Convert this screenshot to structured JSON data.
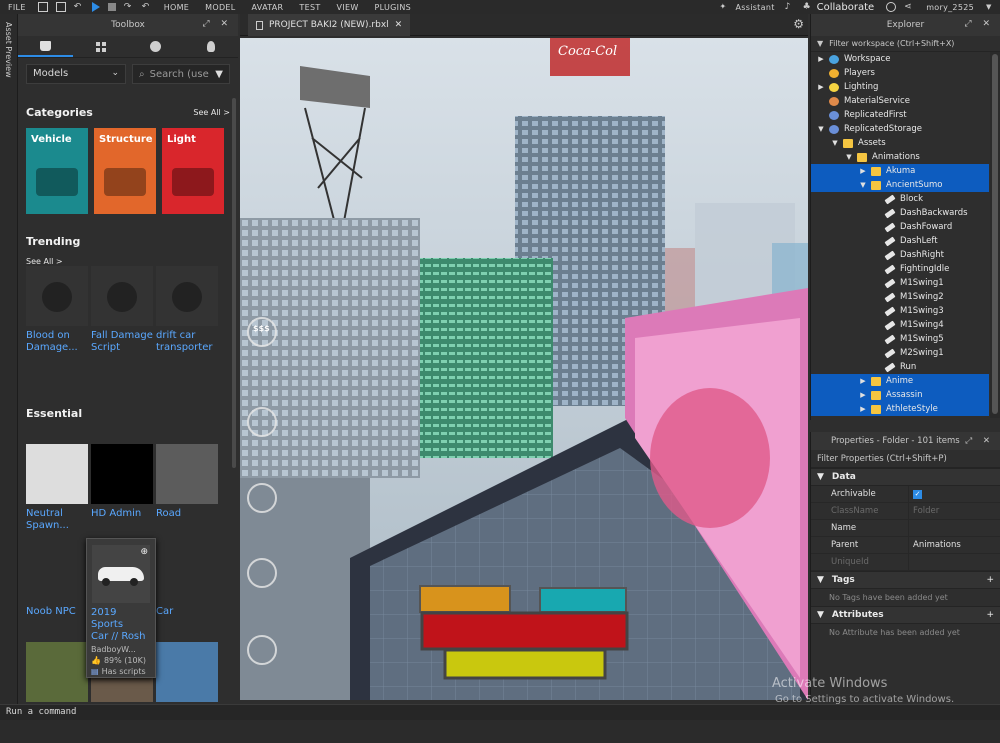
{
  "topbar": {
    "file": "FILE",
    "menus": [
      "HOME",
      "MODEL",
      "AVATAR",
      "TEST",
      "VIEW",
      "PLUGINS"
    ],
    "assistant": "Assistant",
    "collaborate": "Collaborate",
    "user": "mory_2525"
  },
  "leftstrip": {
    "label": "Asset Preview"
  },
  "toolbox": {
    "title": "Toolbox",
    "category_select": "Models",
    "search_placeholder": "Search (use",
    "categories_title": "Categories",
    "see_all": "See All >",
    "categories": [
      {
        "label": "Vehicle",
        "color": "#1b8a8e"
      },
      {
        "label": "Structure",
        "color": "#e2672b"
      },
      {
        "label": "Light",
        "color": "#d9262c"
      }
    ],
    "trending_title": "Trending",
    "trending_see_all": "See All >",
    "trending": [
      {
        "l1": "Blood on",
        "l2": "Damage..."
      },
      {
        "l1": "Fall Damage",
        "l2": "Script"
      },
      {
        "l1": "drift car",
        "l2": "transporter"
      }
    ],
    "essential_title": "Essential",
    "essential": [
      {
        "l1": "Neutral",
        "l2": "Spawn..."
      },
      {
        "l1": "HD Admin",
        "l2": ""
      },
      {
        "l1": "Road",
        "l2": ""
      }
    ],
    "row3": [
      {
        "l1": "Noob NPC"
      },
      {
        "l1": ""
      },
      {
        "l1": "Car"
      }
    ],
    "popup": {
      "name1": "2019 Sports",
      "name2": "Car // Rosh",
      "creator": "BadboyW...",
      "rating": "89% (10K)",
      "scripts": "Has scripts"
    }
  },
  "viewport": {
    "tab": "PROJECT BAKI2 (NEW).rbxl",
    "billboard": "Coca-Col",
    "side_icon": "$$$"
  },
  "explorer": {
    "title": "Explorer",
    "filter": "Filter workspace (Ctrl+Shift+X)",
    "items": [
      {
        "label": "Workspace",
        "depth": 0,
        "arrow": "▶",
        "icon": "#4aa3df",
        "sel": false
      },
      {
        "label": "Players",
        "depth": 0,
        "arrow": "",
        "icon": "#f0b030",
        "sel": false
      },
      {
        "label": "Lighting",
        "depth": 0,
        "arrow": "▶",
        "icon": "#f5d442",
        "sel": false
      },
      {
        "label": "MaterialService",
        "depth": 0,
        "arrow": "",
        "icon": "#e08a4a",
        "sel": false
      },
      {
        "label": "ReplicatedFirst",
        "depth": 0,
        "arrow": "",
        "icon": "#6a8fd8",
        "sel": false
      },
      {
        "label": "ReplicatedStorage",
        "depth": 0,
        "arrow": "▼",
        "icon": "#6a8fd8",
        "sel": false
      },
      {
        "label": "Assets",
        "depth": 1,
        "arrow": "▼",
        "icon": "folder",
        "sel": false
      },
      {
        "label": "Animations",
        "depth": 2,
        "arrow": "▼",
        "icon": "folder",
        "sel": false
      },
      {
        "label": "Akuma",
        "depth": 3,
        "arrow": "▶",
        "icon": "folder",
        "sel": true
      },
      {
        "label": "AncientSumo",
        "depth": 3,
        "arrow": "▼",
        "icon": "folder",
        "sel": true
      },
      {
        "label": "Block",
        "depth": 4,
        "arrow": "",
        "icon": "anim",
        "sel": false
      },
      {
        "label": "DashBackwards",
        "depth": 4,
        "arrow": "",
        "icon": "anim",
        "sel": false
      },
      {
        "label": "DashFoward",
        "depth": 4,
        "arrow": "",
        "icon": "anim",
        "sel": false
      },
      {
        "label": "DashLeft",
        "depth": 4,
        "arrow": "",
        "icon": "anim",
        "sel": false
      },
      {
        "label": "DashRight",
        "depth": 4,
        "arrow": "",
        "icon": "anim",
        "sel": false
      },
      {
        "label": "FightingIdle",
        "depth": 4,
        "arrow": "",
        "icon": "anim",
        "sel": false
      },
      {
        "label": "M1Swing1",
        "depth": 4,
        "arrow": "",
        "icon": "anim",
        "sel": false
      },
      {
        "label": "M1Swing2",
        "depth": 4,
        "arrow": "",
        "icon": "anim",
        "sel": false
      },
      {
        "label": "M1Swing3",
        "depth": 4,
        "arrow": "",
        "icon": "anim",
        "sel": false
      },
      {
        "label": "M1Swing4",
        "depth": 4,
        "arrow": "",
        "icon": "anim",
        "sel": false
      },
      {
        "label": "M1Swing5",
        "depth": 4,
        "arrow": "",
        "icon": "anim",
        "sel": false
      },
      {
        "label": "M2Swing1",
        "depth": 4,
        "arrow": "",
        "icon": "anim",
        "sel": false
      },
      {
        "label": "Run",
        "depth": 4,
        "arrow": "",
        "icon": "anim",
        "sel": false
      },
      {
        "label": "Anime",
        "depth": 3,
        "arrow": "▶",
        "icon": "folder",
        "sel": true
      },
      {
        "label": "Assassin",
        "depth": 3,
        "arrow": "▶",
        "icon": "folder",
        "sel": true
      },
      {
        "label": "AthleteStyle",
        "depth": 3,
        "arrow": "▶",
        "icon": "folder",
        "sel": true
      }
    ]
  },
  "properties": {
    "title": "Properties - Folder - 101 items",
    "filter": "Filter Properties (Ctrl+Shift+P)",
    "data_group": "Data",
    "rows": [
      {
        "k": "Archivable",
        "v": "",
        "check": true,
        "dis": false
      },
      {
        "k": "ClassName",
        "v": "Folder",
        "dis": true
      },
      {
        "k": "Name",
        "v": "",
        "dis": false
      },
      {
        "k": "Parent",
        "v": "Animations",
        "dis": false
      },
      {
        "k": "UniqueId",
        "v": "",
        "dis": true
      }
    ],
    "tags_group": "Tags",
    "tags_empty": "No Tags have been added yet",
    "attr_group": "Attributes",
    "attr_empty": "No Attribute has been added yet"
  },
  "command": {
    "placeholder": "Run a command"
  },
  "watermark": {
    "line1": "Activate Windows",
    "line2": "Go to Settings to activate Windows."
  }
}
